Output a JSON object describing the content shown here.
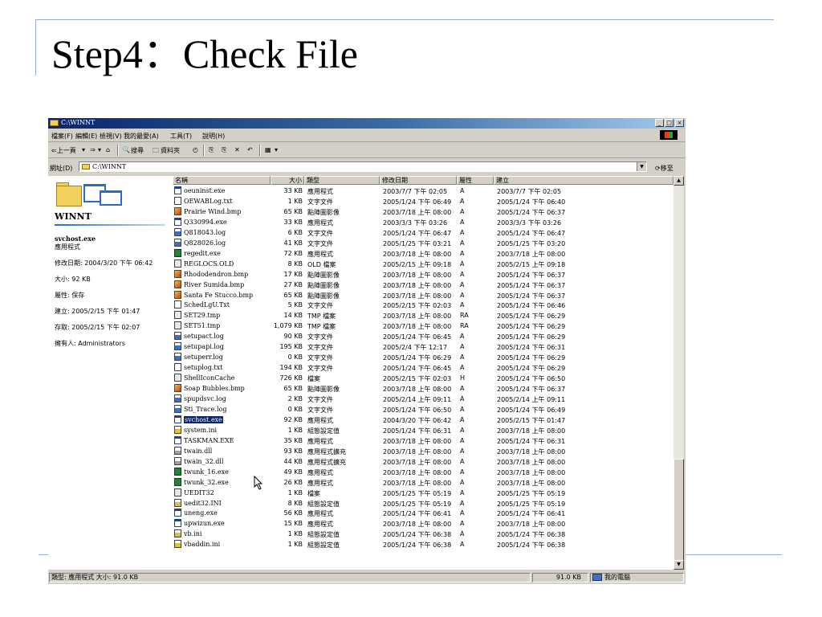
{
  "slide": {
    "title": "Step4：Check File"
  },
  "window": {
    "title": "C:\\WINNT",
    "controls": {
      "minimize": "_",
      "maximize": "□",
      "close": "×"
    }
  },
  "menu": [
    "檔案(F)",
    "編輯(E)",
    "檢視(V)",
    "我的最愛(A)",
    "工具(T)",
    "說明(H)"
  ],
  "toolbar": {
    "back": "⇐上一頁",
    "forward": "⇒",
    "up": "⌂",
    "search": "搜尋",
    "folders": "資料夾",
    "history": "◴",
    "move": "⎘",
    "copy": "⎘",
    "delete": "✕",
    "undo": "↶",
    "views": "▦"
  },
  "address": {
    "label": "網址(D)",
    "value": "C:\\WINNT",
    "go": "移至",
    "go_arrow": "⟳"
  },
  "left_panel": {
    "folder_name": "WINNT",
    "selected_file": "svchost.exe",
    "file_type": "應用程式",
    "modified": "修改日期: 2004/3/20 下午 06:42",
    "size": "大小: 92 KB",
    "attributes": "屬性: 保存",
    "created": "建立: 2005/2/15 下午 01:47",
    "accessed": "存取: 2005/2/15 下午 02:07",
    "owner": "擁有人: Administrators"
  },
  "columns": {
    "name": "名稱",
    "size": "大小",
    "type": "類型",
    "modified": "修改日期",
    "attr": "屬性",
    "created": "建立"
  },
  "files": [
    {
      "icon": "exe",
      "name": "oeuninst.exe",
      "size": "33 KB",
      "type": "應用程式",
      "modified": "2003/7/7 下午 02:05",
      "attr": "A",
      "created": "2003/7/7 下午 02:05"
    },
    {
      "icon": "txt",
      "name": "OEWABLog.txt",
      "size": "1 KB",
      "type": "文字文件",
      "modified": "2005/1/24 下午 06:49",
      "attr": "A",
      "created": "2005/1/24 下午 06:40"
    },
    {
      "icon": "bmp",
      "name": "Prairie Wind.bmp",
      "size": "65 KB",
      "type": "點陣圖影像",
      "modified": "2003/7/18 上午 08:00",
      "attr": "A",
      "created": "2005/1/24 下午 06:37"
    },
    {
      "icon": "exe",
      "name": "Q330994.exe",
      "size": "33 KB",
      "type": "應用程式",
      "modified": "2003/3/3 下午 03:26",
      "attr": "A",
      "created": "2003/3/3 下午 03:26"
    },
    {
      "icon": "log",
      "name": "Q818043.log",
      "size": "6 KB",
      "type": "文字文件",
      "modified": "2005/1/24 下午 06:47",
      "attr": "A",
      "created": "2005/1/24 下午 06:47"
    },
    {
      "icon": "log",
      "name": "Q828026.log",
      "size": "41 KB",
      "type": "文字文件",
      "modified": "2005/1/25 下午 03:21",
      "attr": "A",
      "created": "2005/1/25 下午 03:20"
    },
    {
      "icon": "green",
      "name": "regedit.exe",
      "size": "72 KB",
      "type": "應用程式",
      "modified": "2003/7/18 上午 08:00",
      "attr": "A",
      "created": "2003/7/18 上午 08:00"
    },
    {
      "icon": "sys",
      "name": "REGLOCS.OLD",
      "size": "8 KB",
      "type": "OLD 檔案",
      "modified": "2005/2/15 上午 09:18",
      "attr": "A",
      "created": "2005/2/15 上午 09:18"
    },
    {
      "icon": "bmp",
      "name": "Rhododendron.bmp",
      "size": "17 KB",
      "type": "點陣圖影像",
      "modified": "2003/7/18 上午 08:00",
      "attr": "A",
      "created": "2005/1/24 下午 06:37"
    },
    {
      "icon": "bmp",
      "name": "River Sumida.bmp",
      "size": "27 KB",
      "type": "點陣圖影像",
      "modified": "2003/7/18 上午 08:00",
      "attr": "A",
      "created": "2005/1/24 下午 06:37"
    },
    {
      "icon": "bmp",
      "name": "Santa Fe Stucco.bmp",
      "size": "65 KB",
      "type": "點陣圖影像",
      "modified": "2003/7/18 上午 08:00",
      "attr": "A",
      "created": "2005/1/24 下午 06:37"
    },
    {
      "icon": "txt",
      "name": "SchedLgU.Txt",
      "size": "5 KB",
      "type": "文字文件",
      "modified": "2005/2/15 下午 02:03",
      "attr": "A",
      "created": "2005/1/24 下午 06:46"
    },
    {
      "icon": "sys",
      "name": "SET29.tmp",
      "size": "14 KB",
      "type": "TMP 檔案",
      "modified": "2003/7/18 上午 08:00",
      "attr": "RA",
      "created": "2005/1/24 下午 06:29"
    },
    {
      "icon": "sys",
      "name": "SET51.tmp",
      "size": "1,079 KB",
      "type": "TMP 檔案",
      "modified": "2003/7/18 上午 08:00",
      "attr": "RA",
      "created": "2005/1/24 下午 06:29"
    },
    {
      "icon": "log",
      "name": "setupact.log",
      "size": "90 KB",
      "type": "文字文件",
      "modified": "2005/1/24 下午 06:45",
      "attr": "A",
      "created": "2005/1/24 下午 06:29"
    },
    {
      "icon": "log",
      "name": "setupapi.log",
      "size": "195 KB",
      "type": "文字文件",
      "modified": "2005/2/4 下午 12:17",
      "attr": "A",
      "created": "2005/1/24 下午 06:31"
    },
    {
      "icon": "log",
      "name": "setuperr.log",
      "size": "0 KB",
      "type": "文字文件",
      "modified": "2005/1/24 下午 06:29",
      "attr": "A",
      "created": "2005/1/24 下午 06:29"
    },
    {
      "icon": "txt",
      "name": "setuplog.txt",
      "size": "194 KB",
      "type": "文字文件",
      "modified": "2005/1/24 下午 06:45",
      "attr": "A",
      "created": "2005/1/24 下午 06:29"
    },
    {
      "icon": "sys",
      "name": "ShellIconCache",
      "size": "726 KB",
      "type": "檔案",
      "modified": "2005/2/15 下午 02:03",
      "attr": "H",
      "created": "2005/1/24 下午 06:50"
    },
    {
      "icon": "bmp",
      "name": "Soap Bubbles.bmp",
      "size": "65 KB",
      "type": "點陣圖影像",
      "modified": "2003/7/18 上午 08:00",
      "attr": "A",
      "created": "2005/1/24 下午 06:37"
    },
    {
      "icon": "log",
      "name": "spupdsvc.log",
      "size": "2 KB",
      "type": "文字文件",
      "modified": "2005/2/14 上午 09:11",
      "attr": "A",
      "created": "2005/2/14 上午 09:11"
    },
    {
      "icon": "log",
      "name": "Sti_Trace.log",
      "size": "0 KB",
      "type": "文字文件",
      "modified": "2005/1/24 下午 06:50",
      "attr": "A",
      "created": "2005/1/24 下午 06:49"
    },
    {
      "icon": "exe",
      "name": "svchost.exe",
      "size": "92 KB",
      "type": "應用程式",
      "modified": "2004/3/20 下午 06:42",
      "attr": "A",
      "created": "2005/2/15 下午 01:47",
      "selected": true
    },
    {
      "icon": "ini",
      "name": "system.ini",
      "size": "1 KB",
      "type": "組態設定值",
      "modified": "2005/1/24 下午 06:31",
      "attr": "A",
      "created": "2003/7/18 上午 08:00"
    },
    {
      "icon": "exe",
      "name": "TASKMAN.EXE",
      "size": "35 KB",
      "type": "應用程式",
      "modified": "2003/7/18 上午 08:00",
      "attr": "A",
      "created": "2005/1/24 下午 06:31"
    },
    {
      "icon": "dll",
      "name": "twain.dll",
      "size": "93 KB",
      "type": "應用程式擴充",
      "modified": "2003/7/18 上午 08:00",
      "attr": "A",
      "created": "2003/7/18 上午 08:00"
    },
    {
      "icon": "dll",
      "name": "twain_32.dll",
      "size": "44 KB",
      "type": "應用程式擴充",
      "modified": "2003/7/18 上午 08:00",
      "attr": "A",
      "created": "2003/7/18 上午 08:00"
    },
    {
      "icon": "green",
      "name": "twunk_16.exe",
      "size": "49 KB",
      "type": "應用程式",
      "modified": "2003/7/18 上午 08:00",
      "attr": "A",
      "created": "2003/7/18 上午 08:00"
    },
    {
      "icon": "green",
      "name": "twunk_32.exe",
      "size": "26 KB",
      "type": "應用程式",
      "modified": "2003/7/18 上午 08:00",
      "attr": "A",
      "created": "2003/7/18 上午 08:00"
    },
    {
      "icon": "sys",
      "name": "UEDIT32",
      "size": "1 KB",
      "type": "檔案",
      "modified": "2005/1/25 下午 05:19",
      "attr": "A",
      "created": "2005/1/25 下午 05:19"
    },
    {
      "icon": "ini",
      "name": "uedit32.INI",
      "size": "8 KB",
      "type": "組態設定值",
      "modified": "2005/1/25 下午 05:19",
      "attr": "A",
      "created": "2005/1/25 下午 05:19"
    },
    {
      "icon": "exe",
      "name": "uneng.exe",
      "size": "56 KB",
      "type": "應用程式",
      "modified": "2005/1/24 下午 06:41",
      "attr": "A",
      "created": "2005/1/24 下午 06:41"
    },
    {
      "icon": "exe",
      "name": "upwizun.exe",
      "size": "15 KB",
      "type": "應用程式",
      "modified": "2003/7/18 上午 08:00",
      "attr": "A",
      "created": "2003/7/18 上午 08:00"
    },
    {
      "icon": "ini",
      "name": "vb.ini",
      "size": "1 KB",
      "type": "組態設定值",
      "modified": "2005/1/24 下午 06:38",
      "attr": "A",
      "created": "2005/1/24 下午 06:38"
    },
    {
      "icon": "ini",
      "name": "vbaddin.ini",
      "size": "1 KB",
      "type": "組態設定值",
      "modified": "2005/1/24 下午 06:38",
      "attr": "A",
      "created": "2005/1/24 下午 06:38"
    }
  ],
  "status": {
    "left": "類型: 應用程式 大小: 91.0 KB",
    "size": "91.0 KB",
    "zone": "我的電腦"
  }
}
